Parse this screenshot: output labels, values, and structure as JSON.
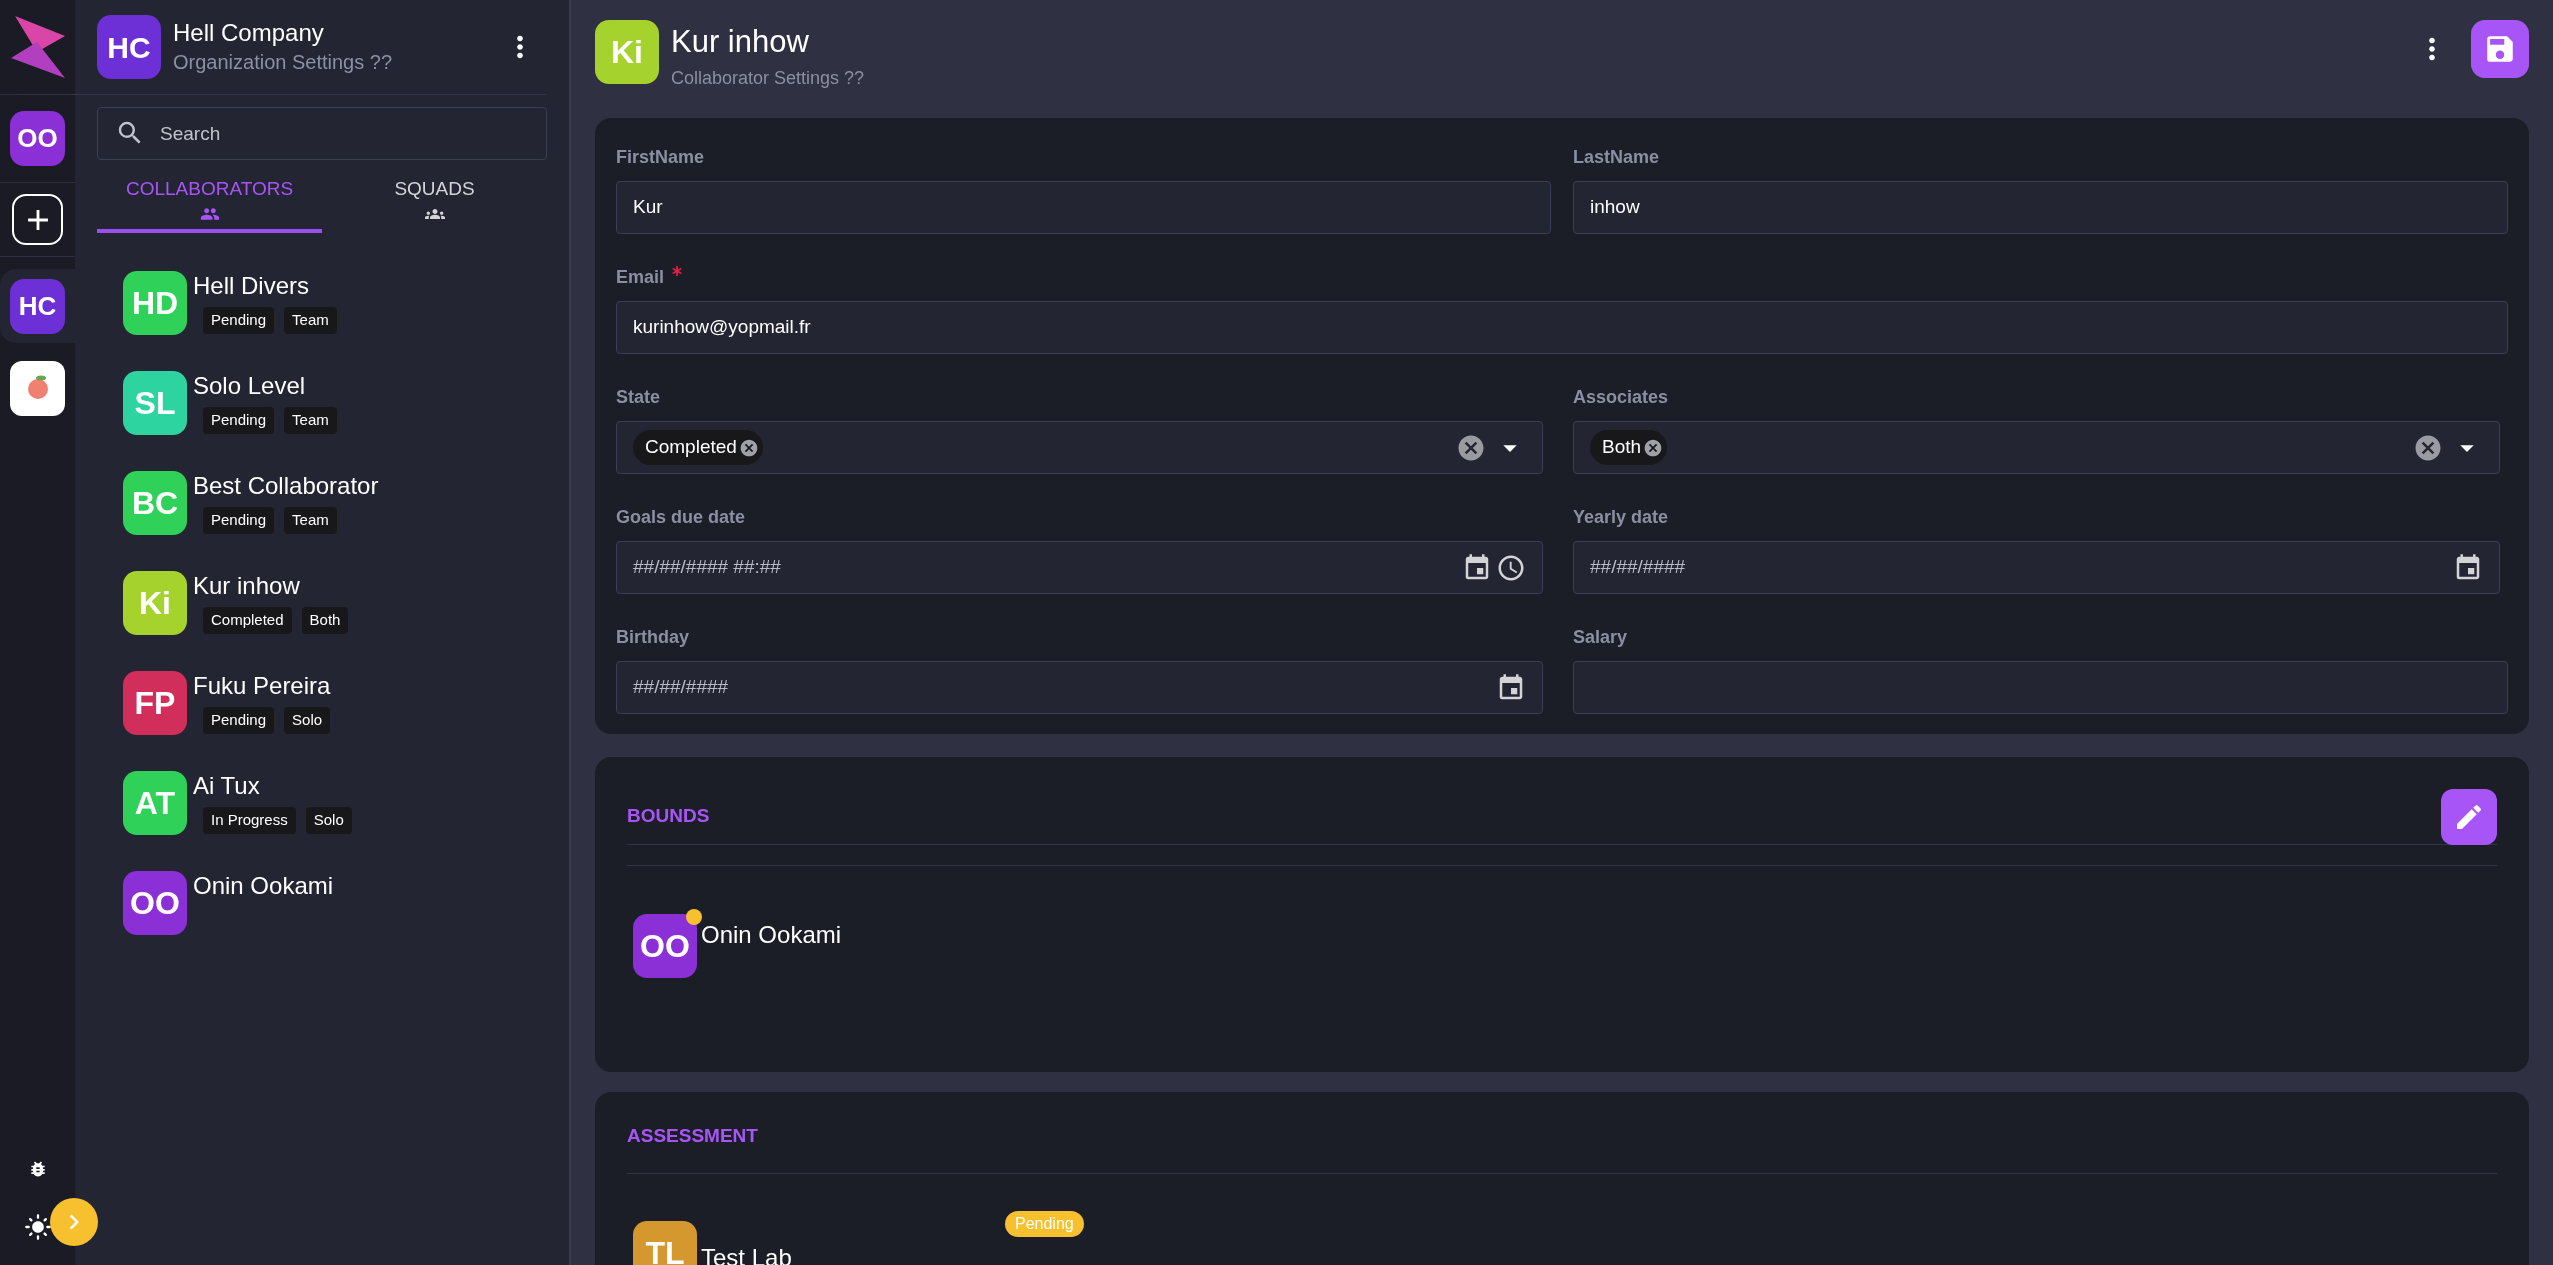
{
  "rail": {
    "user": {
      "initials": "OO",
      "color": "#8b2fd6"
    },
    "organizations": [
      {
        "kind": "initials",
        "initials": "HC",
        "color": "#6d2fd6",
        "selected": true
      },
      {
        "kind": "logo",
        "selected": false
      }
    ]
  },
  "sidebar": {
    "organization": {
      "initials": "HC",
      "color": "#6d2fd6",
      "name": "Hell Company",
      "subtitle": "Organization Settings ??"
    },
    "search": {
      "placeholder": "Search"
    },
    "tabs": [
      {
        "label": "COLLABORATORS",
        "kind": "people",
        "selected": true
      },
      {
        "label": "SQUADS",
        "kind": "groups",
        "selected": false
      }
    ],
    "collaborators": [
      {
        "initials": "HD",
        "name": "Hell Divers",
        "color": "#2fd158",
        "tags": [
          "Pending",
          "Team"
        ]
      },
      {
        "initials": "SL",
        "name": "Solo Level",
        "color": "#2dd4a0",
        "tags": [
          "Pending",
          "Team"
        ]
      },
      {
        "initials": "BC",
        "name": "Best Collaborator",
        "color": "#2fd158",
        "tags": [
          "Pending",
          "Team"
        ]
      },
      {
        "initials": "Ki",
        "name": "Kur inhow",
        "color": "#a6d22e",
        "tags": [
          "Completed",
          "Both"
        ]
      },
      {
        "initials": "FP",
        "name": "Fuku Pereira",
        "color": "#d12e5c",
        "tags": [
          "Pending",
          "Solo"
        ]
      },
      {
        "initials": "AT",
        "name": "Ai Tux",
        "color": "#2fd158",
        "tags": [
          "In Progress",
          "Solo"
        ]
      },
      {
        "initials": "OO",
        "name": "Onin Ookami",
        "color": "#8b2fd6"
      }
    ]
  },
  "header": {
    "initials": "Ki",
    "color": "#a6d22e",
    "title": "Kur inhow",
    "subtitle": "Collaborator Settings ??"
  },
  "form": {
    "rows": [
      [
        {
          "kind": "text",
          "label": "FirstName",
          "value": "Kur",
          "required": false
        },
        {
          "kind": "text",
          "label": "LastName",
          "value": "inhow",
          "required": false
        }
      ],
      [
        {
          "kind": "text",
          "label": "Email",
          "value": "kurinhow@yopmail.fr",
          "required": true
        }
      ],
      [
        {
          "kind": "select",
          "label": "State",
          "chips": [
            "Completed"
          ],
          "required": false
        },
        {
          "kind": "select",
          "label": "Associates",
          "chips": [
            "Both"
          ],
          "required": false
        }
      ],
      [
        {
          "kind": "datetime",
          "label": "Goals due date",
          "placeholder": "##/##/#### ##:##",
          "required": false
        },
        {
          "kind": "date",
          "label": "Yearly date",
          "placeholder": "##/##/####",
          "required": false
        }
      ],
      [
        {
          "kind": "date",
          "label": "Birthday",
          "placeholder": "##/##/####",
          "required": false
        },
        {
          "kind": "text",
          "label": "Salary",
          "required": false
        }
      ]
    ]
  },
  "bounds": {
    "title": "BOUNDS",
    "members": [
      {
        "initials": "OO",
        "name": "Onin Ookami",
        "color": "#8b2fd6",
        "online": true
      }
    ]
  },
  "assessment": {
    "title": "ASSESSMENT",
    "items": [
      {
        "initials": "TL",
        "name": "Test Lab",
        "color": "#d4982e",
        "status": "Pending"
      }
    ]
  }
}
